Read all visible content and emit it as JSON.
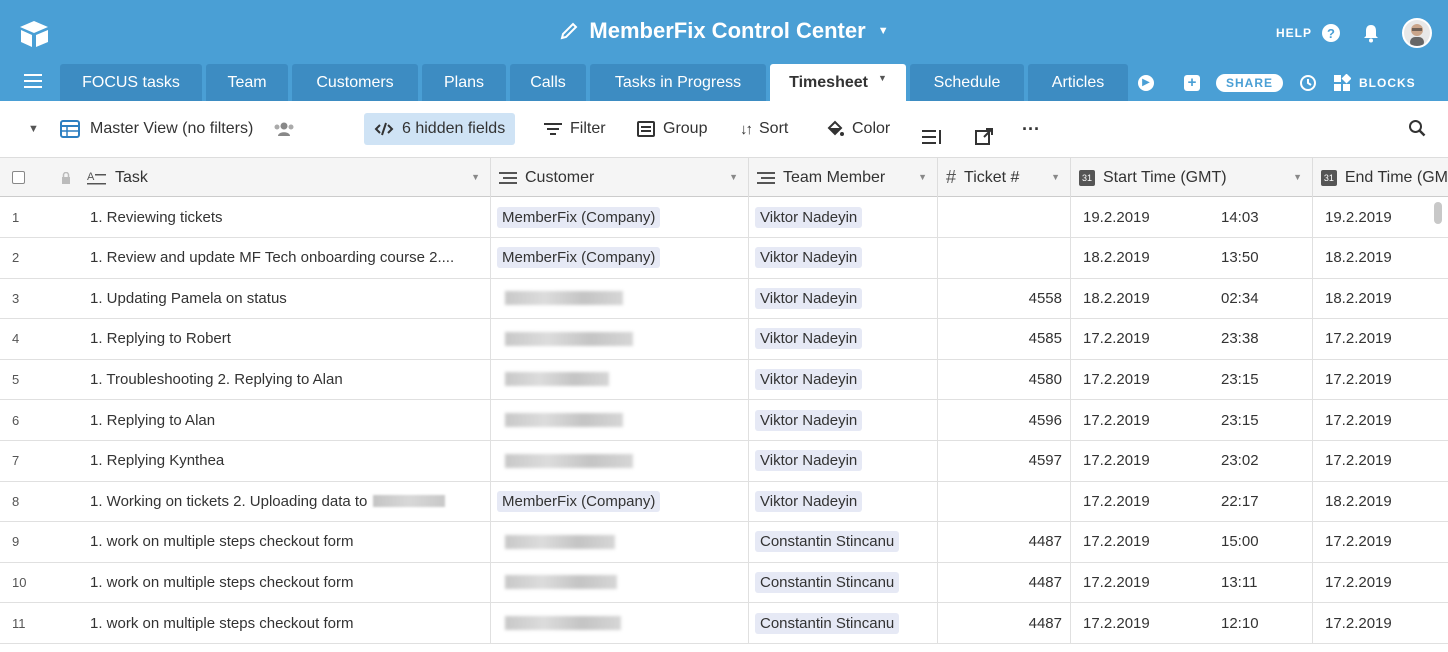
{
  "app": {
    "title": "MemberFix Control Center",
    "help": "HELP",
    "share": "SHARE",
    "blocks": "BLOCKS"
  },
  "tabs": [
    {
      "label": "FOCUS tasks"
    },
    {
      "label": "Team"
    },
    {
      "label": "Customers"
    },
    {
      "label": "Plans"
    },
    {
      "label": "Calls"
    },
    {
      "label": "Tasks in Progress"
    },
    {
      "label": "Timesheet",
      "active": true
    },
    {
      "label": "Schedule"
    },
    {
      "label": "Articles"
    }
  ],
  "toolbar": {
    "view": "Master View (no filters)",
    "hidden_fields": "6 hidden fields",
    "filter": "Filter",
    "group": "Group",
    "sort": "Sort",
    "color": "Color"
  },
  "columns": {
    "task": "Task",
    "customer": "Customer",
    "team_member": "Team Member",
    "ticket": "Ticket #",
    "start": "Start Time (GMT)",
    "end": "End Time (GM"
  },
  "rows": [
    {
      "n": "1",
      "task": "1. Reviewing tickets",
      "customer": "MemberFix (Company)",
      "member": "Viktor Nadeyin",
      "ticket": "",
      "start_date": "19.2.2019",
      "start_time": "14:03",
      "end_date": "19.2.2019"
    },
    {
      "n": "2",
      "task": "1. Review and update MF Tech onboarding course 2....",
      "customer": "MemberFix (Company)",
      "member": "Viktor Nadeyin",
      "ticket": "",
      "start_date": "18.2.2019",
      "start_time": "13:50",
      "end_date": "18.2.2019"
    },
    {
      "n": "3",
      "task": "1. Updating Pamela on status",
      "customer": "",
      "member": "Viktor Nadeyin",
      "ticket": "4558",
      "start_date": "18.2.2019",
      "start_time": "02:34",
      "end_date": "18.2.2019"
    },
    {
      "n": "4",
      "task": "1. Replying to Robert",
      "customer": "",
      "member": "Viktor Nadeyin",
      "ticket": "4585",
      "start_date": "17.2.2019",
      "start_time": "23:38",
      "end_date": "17.2.2019"
    },
    {
      "n": "5",
      "task": "1. Troubleshooting 2. Replying to Alan",
      "customer": "",
      "member": "Viktor Nadeyin",
      "ticket": "4580",
      "start_date": "17.2.2019",
      "start_time": "23:15",
      "end_date": "17.2.2019"
    },
    {
      "n": "6",
      "task": "1. Replying to Alan",
      "customer": "",
      "member": "Viktor Nadeyin",
      "ticket": "4596",
      "start_date": "17.2.2019",
      "start_time": "23:15",
      "end_date": "17.2.2019"
    },
    {
      "n": "7",
      "task": "1. Replying Kynthea",
      "customer": "",
      "member": "Viktor Nadeyin",
      "ticket": "4597",
      "start_date": "17.2.2019",
      "start_time": "23:02",
      "end_date": "17.2.2019"
    },
    {
      "n": "8",
      "task": "1. Working on tickets 2. Uploading data to",
      "customer": "MemberFix (Company)",
      "member": "Viktor Nadeyin",
      "ticket": "",
      "start_date": "17.2.2019",
      "start_time": "22:17",
      "end_date": "18.2.2019"
    },
    {
      "n": "9",
      "task": "1. work on multiple steps checkout form",
      "customer": "",
      "member": "Constantin Stincanu",
      "ticket": "4487",
      "start_date": "17.2.2019",
      "start_time": "15:00",
      "end_date": "17.2.2019"
    },
    {
      "n": "10",
      "task": "1. work on multiple steps checkout form",
      "customer": "",
      "member": "Constantin Stincanu",
      "ticket": "4487",
      "start_date": "17.2.2019",
      "start_time": "13:11",
      "end_date": "17.2.2019"
    },
    {
      "n": "11",
      "task": "1. work on multiple steps checkout form",
      "customer": "",
      "member": "Constantin Stincanu",
      "ticket": "4487",
      "start_date": "17.2.2019",
      "start_time": "12:10",
      "end_date": "17.2.2019"
    }
  ]
}
